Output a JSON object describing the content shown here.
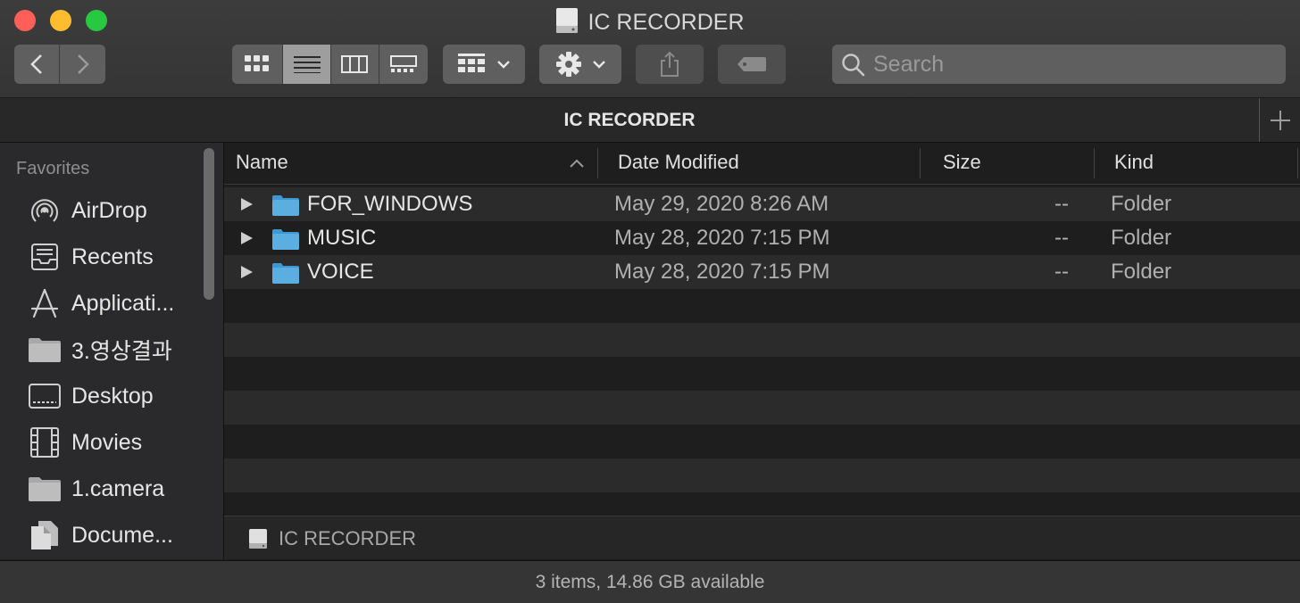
{
  "window": {
    "title": "IC RECORDER"
  },
  "toolbar": {
    "back_icon": "chevron-left-icon",
    "forward_icon": "chevron-right-icon",
    "view_modes": [
      "icon-view",
      "list-view",
      "column-view",
      "gallery-view"
    ],
    "active_view": "list-view",
    "group_icon": "group-grid-icon",
    "action_icon": "gear-icon",
    "share_icon": "share-icon",
    "tag_icon": "tag-icon"
  },
  "search": {
    "placeholder": "Search"
  },
  "tab": {
    "title": "IC RECORDER",
    "add_label": "+"
  },
  "sidebar": {
    "section": "Favorites",
    "items": [
      {
        "label": "AirDrop",
        "icon": "airdrop-icon"
      },
      {
        "label": "Recents",
        "icon": "recents-icon"
      },
      {
        "label": "Applicati...",
        "icon": "applications-icon"
      },
      {
        "label": "3.영상결과",
        "icon": "folder-icon"
      },
      {
        "label": "Desktop",
        "icon": "desktop-icon"
      },
      {
        "label": "Movies",
        "icon": "movies-icon"
      },
      {
        "label": "1.camera",
        "icon": "folder-icon"
      },
      {
        "label": "Docume...",
        "icon": "documents-icon"
      }
    ]
  },
  "columns": {
    "name": "Name",
    "date": "Date Modified",
    "size": "Size",
    "kind": "Kind"
  },
  "files": [
    {
      "name": "FOR_WINDOWS",
      "date": "May 29, 2020 8:26 AM",
      "size": "--",
      "kind": "Folder"
    },
    {
      "name": "MUSIC",
      "date": "May 28, 2020 7:15 PM",
      "size": "--",
      "kind": "Folder"
    },
    {
      "name": "VOICE",
      "date": "May 28, 2020 7:15 PM",
      "size": "--",
      "kind": "Folder"
    }
  ],
  "pathbar": {
    "label": "IC RECORDER"
  },
  "status": {
    "text": "3 items, 14.86 GB available"
  },
  "colors": {
    "folder": "#5aaee0",
    "accent_red": "#ff5f57",
    "accent_yellow": "#febc2e",
    "accent_green": "#28c840"
  }
}
